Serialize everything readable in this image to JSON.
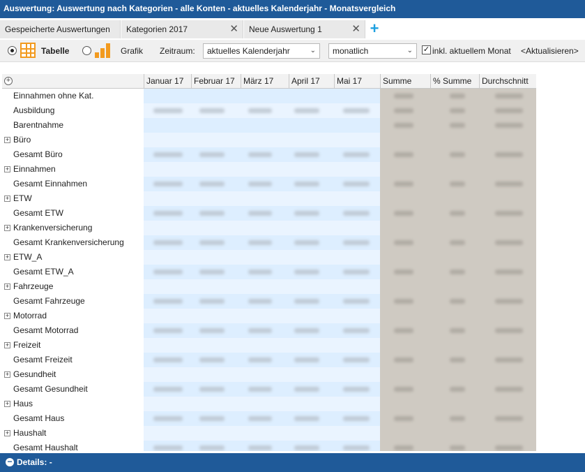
{
  "window": {
    "title": "Auswertung: Auswertung nach Kategorien - alle Konten - aktuelles Kalenderjahr - Monatsvergleich"
  },
  "tabs": [
    {
      "label": "Gespeicherte Auswertungen",
      "closable": false
    },
    {
      "label": "Kategorien 2017",
      "closable": true
    },
    {
      "label": "Neue Auswertung 1",
      "closable": true
    }
  ],
  "toolbar": {
    "view_table_label": "Tabelle",
    "view_chart_label": "Grafik",
    "selected_view": "Tabelle",
    "period_label": "Zeitraum:",
    "period_value": "aktuelles Kalenderjahr",
    "interval_value": "monatlich",
    "include_current_month_label": "inkl. aktuellem Monat",
    "include_current_month_checked": true,
    "refresh_label": "<Aktualisieren>"
  },
  "table": {
    "columns": [
      "Januar 17",
      "Februar 17",
      "März 17",
      "April 17",
      "Mai 17",
      "Summe",
      "% Summe",
      "Durchschnitt"
    ],
    "rows": [
      {
        "label": "Einnahmen ohne Kat.",
        "expandable": false
      },
      {
        "label": "Ausbildung",
        "expandable": false
      },
      {
        "label": "Barentnahme",
        "expandable": false
      },
      {
        "label": "Büro",
        "expandable": true
      },
      {
        "label": "Gesamt Büro",
        "expandable": false
      },
      {
        "label": "Einnahmen",
        "expandable": true
      },
      {
        "label": "Gesamt Einnahmen",
        "expandable": false
      },
      {
        "label": "ETW",
        "expandable": true
      },
      {
        "label": "Gesamt ETW",
        "expandable": false
      },
      {
        "label": "Krankenversicherung",
        "expandable": true
      },
      {
        "label": "Gesamt Krankenversicherung",
        "expandable": false
      },
      {
        "label": "ETW_A",
        "expandable": true
      },
      {
        "label": "Gesamt ETW_A",
        "expandable": false
      },
      {
        "label": "Fahrzeuge",
        "expandable": true
      },
      {
        "label": "Gesamt Fahrzeuge",
        "expandable": false
      },
      {
        "label": "Motorrad",
        "expandable": true
      },
      {
        "label": "Gesamt Motorrad",
        "expandable": false
      },
      {
        "label": "Freizeit",
        "expandable": true
      },
      {
        "label": "Gesamt Freizeit",
        "expandable": false
      },
      {
        "label": "Gesundheit",
        "expandable": true
      },
      {
        "label": "Gesamt Gesundheit",
        "expandable": false
      },
      {
        "label": "Haus",
        "expandable": true
      },
      {
        "label": "Gesamt Haus",
        "expandable": false
      },
      {
        "label": "Haushalt",
        "expandable": true
      },
      {
        "label": "Gesamt Haushalt",
        "expandable": false
      }
    ]
  },
  "details": {
    "label": "Details:",
    "value": "-"
  },
  "colors": {
    "title_bar": "#1f5a99",
    "accent_plus": "#1ea0e0",
    "icon_orange": "#f29a1f",
    "row_highlight": "#ddeeff",
    "summary_area": "#cfcac2"
  }
}
